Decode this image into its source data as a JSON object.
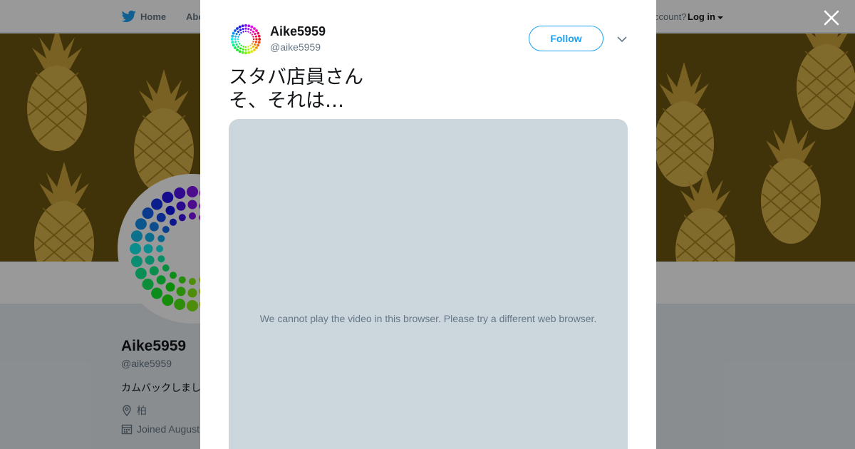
{
  "topnav": {
    "home_label": "Home",
    "about_label": "Abo",
    "account_prompt": "ccount?",
    "login_label": "Log in"
  },
  "profile": {
    "name": "Aike5959",
    "handle": "@aike5959",
    "bio": "カムバックしまし",
    "location": "柏",
    "joined": "Joined August"
  },
  "modal": {
    "name": "Aike5959",
    "handle": "@aike5959",
    "follow_label": "Follow",
    "tweet_text": "スタバ店員さん\nそ、それは…",
    "video_message": "We cannot play the video in this browser. Please try a different web browser."
  },
  "icons": {
    "close": "close-icon",
    "chevron": "chevron-down-icon",
    "bird": "twitter-bird-icon",
    "location": "location-pin-icon",
    "calendar": "calendar-icon"
  },
  "colors": {
    "accent": "#1da1f2",
    "banner": "#6b5410",
    "video_bg": "#ccd6dd",
    "text": "#14171a",
    "muted": "#657786"
  }
}
